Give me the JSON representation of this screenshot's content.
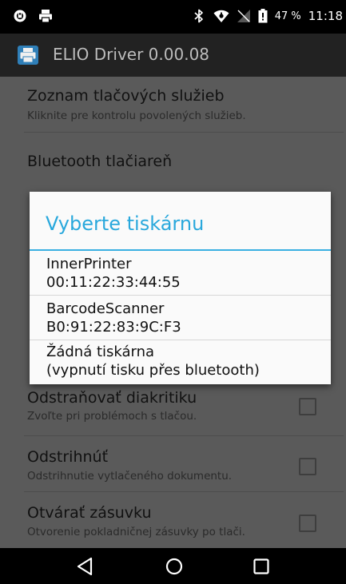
{
  "status_bar": {
    "left_icons": [
      "notification-icon",
      "printer-notification-icon"
    ],
    "right_icons": [
      "bluetooth-icon",
      "wifi-icon",
      "no-signal-icon",
      "battery-icon"
    ],
    "battery": "47 %",
    "time": "11:18"
  },
  "app": {
    "icon": "printer-icon",
    "title": "ELIO Driver 0.00.08"
  },
  "settings": [
    {
      "title": "Zoznam tlačových služieb",
      "subtitle": "Kliknite pre kontrolu povolených služieb."
    },
    {
      "title": "Bluetooth tlačiareň",
      "subtitle": ""
    },
    {
      "title": "Odstraňovať diakritiku",
      "subtitle": "Zvoľte pri problémoch s tlačou.",
      "checked": false
    },
    {
      "title": "Odstrihnúť",
      "subtitle": "Odstrihnutie vytlačeného dokumentu.",
      "checked": false
    },
    {
      "title": "Otvárať zásuvku",
      "subtitle": "Otvorenie pokladničnej zásuvky po tlači.",
      "checked": false
    }
  ],
  "dialog": {
    "title": "Vyberte tiskárnu",
    "options": [
      {
        "line1": "InnerPrinter",
        "line2": "00:11:22:33:44:55"
      },
      {
        "line1": "BarcodeScanner",
        "line2": "B0:91:22:83:9C:F3"
      },
      {
        "line1": "Žádná tiskárna",
        "line2": "(vypnutí tisku přes bluetooth)"
      }
    ]
  },
  "nav_bar": {
    "buttons": [
      "back-icon",
      "home-icon",
      "recents-icon"
    ]
  }
}
